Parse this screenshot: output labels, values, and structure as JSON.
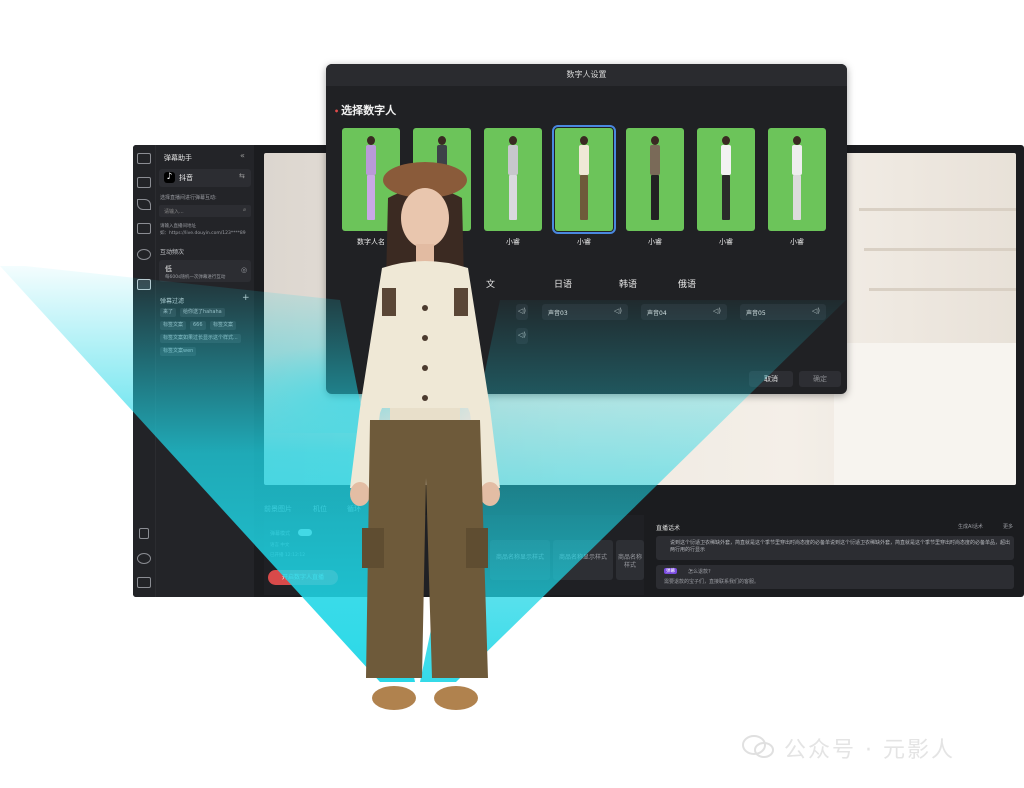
{
  "dialog": {
    "title": "数字人设置",
    "section_title": "选择数字人",
    "avatars": [
      {
        "name": "数字人名"
      },
      {
        "name": ""
      },
      {
        "name": "小睿"
      },
      {
        "name": "小睿",
        "selected": true
      },
      {
        "name": "小睿"
      },
      {
        "name": "小睿"
      },
      {
        "name": "小睿"
      }
    ],
    "languages": [
      "文",
      "日语",
      "韩语",
      "俄语"
    ],
    "voices": [
      "声音03",
      "声音04",
      "声音05"
    ],
    "voice_speaker_icon": "speaker-icon",
    "cancel_label": "取消",
    "confirm_label": "确定"
  },
  "panel": {
    "title": "弹幕助手",
    "platform": "抖音",
    "choose_room": "选择直播间进行弹幕互动:",
    "input_placeholder": "请输入...",
    "hint_line1": "请输入直播间地址",
    "hint_line2": "如：https://live.douyin.com/123****89",
    "freq_label": "互动频次",
    "freq_value": "低",
    "freq_desc": "每600s随机一次弹幕进行互动",
    "filter_label": "弹幕过滤",
    "filter_add": "+",
    "tags": [
      "来了",
      "给你送了hahaha",
      "标签文案",
      "666",
      "标签文案",
      "标签文案如果过长显示这个样式...",
      "标签文案wen"
    ]
  },
  "bottom": {
    "tabs": [
      "前景图片",
      "机位",
      "循环"
    ],
    "barrage_mode": "弹幕模式",
    "lang": "语言 中文",
    "duration": "已开播 12:12:12",
    "cards": [
      "商品名称显示样式",
      "商品名称显示样式",
      "商品名称样式"
    ],
    "live_button": "开启数字人直播"
  },
  "script": {
    "title": "直播话术",
    "generate": "生成AI话术",
    "more": "更多",
    "message1": "说到这个衍适卫衣稀缺外套，简直就是这个季节里穿出时尚态度的必备单说到这个衍适卫衣稀缺外套，简直就是这个季节里穿出时尚态度的必备单品，超出两行用的行显示",
    "tag": "弹幕",
    "message2_q": "怎么退款?",
    "message2_a": "需要退款的宝子们，直接联系我们的客服。"
  },
  "watermark": {
    "text": "公众号 · 元影人"
  },
  "colors": {
    "accent_cyan": "#22d3e0",
    "live_red": "#d84a4a",
    "select_blue": "#4a88e0",
    "green_screen": "#6cc45a"
  }
}
